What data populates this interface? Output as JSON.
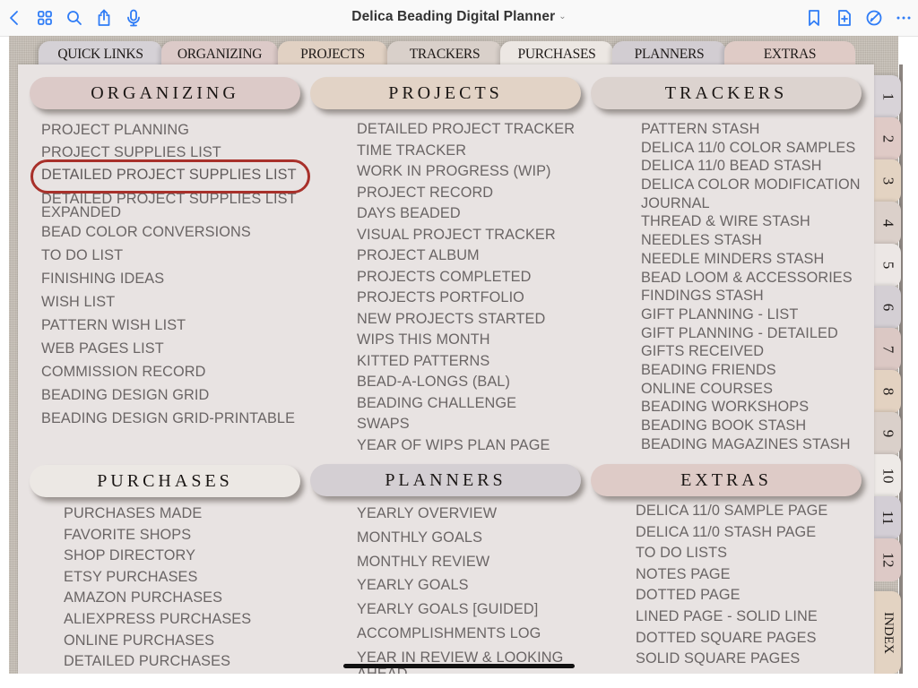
{
  "app": {
    "title": "Delica Beading Digital Planner",
    "title_chevron": "⌄",
    "left_icons": [
      "back-icon",
      "grid-icon",
      "search-icon",
      "share-icon",
      "microphone-icon"
    ],
    "right_icons": [
      "bookmark-icon",
      "add-page-icon",
      "markup-icon",
      "more-icon"
    ]
  },
  "top_tabs": [
    {
      "label": "QUICK LINKS",
      "color": "#d5d1d6"
    },
    {
      "label": "ORGANIZING",
      "color": "#dccac8"
    },
    {
      "label": "PROJECTS",
      "color": "#e1d1c3"
    },
    {
      "label": "TRACKERS",
      "color": "#d9d0ca"
    },
    {
      "label": "PURCHASES",
      "color": "#ece7e3"
    },
    {
      "label": "PLANNERS",
      "color": "#d2cdd2"
    },
    {
      "label": "EXTRAS",
      "color": "#dfcbc6"
    }
  ],
  "side_tabs": [
    {
      "label": "1",
      "color": "#d8d3d8"
    },
    {
      "label": "2",
      "color": "#dfcac6"
    },
    {
      "label": "3",
      "color": "#e3d3c2"
    },
    {
      "label": "4",
      "color": "#dbd0ca"
    },
    {
      "label": "5",
      "color": "#ece7e5"
    },
    {
      "label": "6",
      "color": "#d4cfd4"
    },
    {
      "label": "7",
      "color": "#dbc8c4"
    },
    {
      "label": "8",
      "color": "#e3d2c1"
    },
    {
      "label": "9",
      "color": "#dad0ca"
    },
    {
      "label": "10",
      "color": "#eeeae7"
    },
    {
      "label": "11",
      "color": "#d3ced5"
    },
    {
      "label": "12",
      "color": "#ddc9c6"
    },
    {
      "label": "INDEX",
      "color": "#e3d3c2"
    }
  ],
  "sections": {
    "organizing": {
      "title": "ORGANIZING",
      "color": "#dccac8",
      "items": [
        "PROJECT PLANNING",
        "PROJECT SUPPLIES LIST",
        "DETAILED PROJECT SUPPLIES LIST",
        "DETAILED PROJECT SUPPLIES LIST EXPANDED",
        "BEAD COLOR CONVERSIONS",
        "TO DO LIST",
        "FINISHING IDEAS",
        "WISH LIST",
        "PATTERN WISH LIST",
        "WEB PAGES LIST",
        "COMMISSION RECORD",
        "BEADING DESIGN GRID",
        "BEADING DESIGN GRID-PRINTABLE"
      ],
      "highlighted_item": "DETAILED PROJECT SUPPLIES LIST",
      "highlight_color": "#a8302a"
    },
    "projects": {
      "title": "PROJECTS",
      "color": "#e2d3c6",
      "items": [
        "DETAILED PROJECT TRACKER",
        "TIME TRACKER",
        "WORK IN PROGRESS (WIP)",
        "PROJECT RECORD",
        "DAYS BEADED",
        "VISUAL PROJECT TRACKER",
        "PROJECT ALBUM",
        "PROJECTS COMPLETED",
        "PROJECTS PORTFOLIO",
        "NEW PROJECTS STARTED",
        "WIPS THIS MONTH",
        "KITTED PATTERNS",
        "BEAD-A-LONGS (BAL)",
        "BEADING CHALLENGE",
        "SWAPS",
        "YEAR OF WIPS PLAN PAGE"
      ]
    },
    "trackers": {
      "title": "TRACKERS",
      "color": "#dcd3cf",
      "items": [
        "PATTERN STASH",
        "DELICA 11/0 COLOR SAMPLES",
        "DELICA 11/0 BEAD STASH",
        "DELICA COLOR MODIFICATION",
        "JOURNAL",
        "THREAD & WIRE STASH",
        "NEEDLES STASH",
        "NEEDLE MINDERS STASH",
        "BEAD LOOM & ACCESSORIES",
        "FINDINGS STASH",
        "GIFT PLANNING - LIST",
        "GIFT PLANNING - DETAILED",
        "GIFTS RECEIVED",
        "BEADING FRIENDS",
        "ONLINE COURSES",
        "BEADING WORKSHOPS",
        "BEADING BOOK STASH",
        "BEADING MAGAZINES STASH"
      ]
    },
    "purchases": {
      "title": "PURCHASES",
      "color": "#ece8e4",
      "items": [
        "PURCHASES MADE",
        "FAVORITE SHOPS",
        "SHOP DIRECTORY",
        "ETSY PURCHASES",
        "AMAZON PURCHASES",
        "ALIEXPRESS PURCHASES",
        "ONLINE PURCHASES",
        "DETAILED PURCHASES"
      ]
    },
    "planners": {
      "title": "PLANNERS",
      "color": "#d4cfd3",
      "items": [
        "YEARLY OVERVIEW",
        "MONTHLY GOALS",
        "MONTHLY REVIEW",
        "YEARLY GOALS",
        "YEARLY GOALS [GUIDED]",
        "ACCOMPLISHMENTS LOG",
        "YEAR IN REVIEW & LOOKING AHEAD"
      ]
    },
    "extras": {
      "title": "EXTRAS",
      "color": "#decbc7",
      "items": [
        "DELICA 11/0 SAMPLE PAGE",
        "DELICA 11/0 STASH PAGE",
        "TO DO LISTS",
        "NOTES PAGE",
        "DOTTED PAGE",
        "LINED PAGE - SOLID LINE",
        "DOTTED SQUARE PAGES",
        "SOLID SQUARE PAGES"
      ]
    }
  }
}
